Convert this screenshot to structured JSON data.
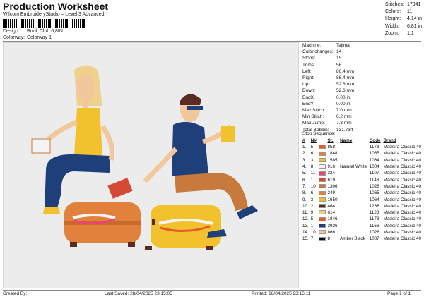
{
  "header": {
    "title": "Production Worksheet",
    "subtitle": "Wilcom EmbroideryStudio – Level 3 Advanced",
    "design_label": "Design:",
    "design_value": "Book Club 6,8IN",
    "colorway_label": "Colorway:",
    "colorway_value": "Colorway 1"
  },
  "stats": [
    {
      "label": "Stitches:",
      "value": "17941"
    },
    {
      "label": "Colors:",
      "value": "11"
    },
    {
      "label": "Height:",
      "value": "4.14 in"
    },
    {
      "label": "Width:",
      "value": "6.81 in"
    },
    {
      "label": "Zoom:",
      "value": "1:1"
    }
  ],
  "properties": [
    {
      "label": "Machine:",
      "value": "Tajima"
    },
    {
      "label": "Color changes:",
      "value": "14"
    },
    {
      "label": "Stops:",
      "value": "15"
    },
    {
      "label": "Trims:",
      "value": "56"
    },
    {
      "label": "Left:",
      "value": "86.4 mm"
    },
    {
      "label": "Right:",
      "value": "86.4 mm"
    },
    {
      "label": "Up:",
      "value": "52.6 mm"
    },
    {
      "label": "Down:",
      "value": "52.6 mm"
    },
    {
      "label": "EndX:",
      "value": "0.00 in"
    },
    {
      "label": "EndY:",
      "value": "0.00 in"
    },
    {
      "label": "Max Stitch:",
      "value": "7.0 mm"
    },
    {
      "label": "Min Stitch:",
      "value": "0.2 mm"
    },
    {
      "label": "Max Jump:",
      "value": "7.3 mm"
    },
    {
      "label": "Total Bobbin:",
      "value": "131.73ft"
    }
  ],
  "sequence": {
    "title": "Stop Sequence:",
    "headers": [
      "#",
      "N#",
      "",
      "St.",
      "Name",
      "Code",
      "Brand"
    ],
    "rows": [
      {
        "n": "1.",
        "nn": "5",
        "color": "#e85a2c",
        "st": "858",
        "name": "",
        "code": "1173",
        "brand": "Madeira Classic 40"
      },
      {
        "n": "2.",
        "nn": "6",
        "color": "#e2813c",
        "st": "1848",
        "name": "",
        "code": "1065",
        "brand": "Madeira Classic 40"
      },
      {
        "n": "3.",
        "nn": "3",
        "color": "#f2c12e",
        "st": "1585",
        "name": "",
        "code": "1064",
        "brand": "Madeira Classic 40"
      },
      {
        "n": "4.",
        "nn": "8",
        "color": "#f4f4f4",
        "st": "916",
        "name": "Natural White",
        "code": "1004",
        "brand": "Madeira Classic 40"
      },
      {
        "n": "5.",
        "nn": "11",
        "color": "#e7466e",
        "st": "324",
        "name": "",
        "code": "1107",
        "brand": "Madeira Classic 40"
      },
      {
        "n": "6.",
        "nn": "1",
        "color": "#d44a36",
        "st": "619",
        "name": "",
        "code": "1146",
        "brand": "Madeira Classic 40"
      },
      {
        "n": "7.",
        "nn": "10",
        "color": "#c77a3c",
        "st": "1306",
        "name": "",
        "code": "1026",
        "brand": "Madeira Classic 40"
      },
      {
        "n": "8.",
        "nn": "6",
        "color": "#e2813c",
        "st": "249",
        "name": "",
        "code": "1065",
        "brand": "Madeira Classic 40"
      },
      {
        "n": "9.",
        "nn": "3",
        "color": "#f2c12e",
        "st": "1650",
        "name": "",
        "code": "1064",
        "brand": "Madeira Classic 40"
      },
      {
        "n": "10.",
        "nn": "2",
        "color": "#5a2a24",
        "st": "464",
        "name": "",
        "code": "1236",
        "brand": "Madeira Classic 40"
      },
      {
        "n": "11.",
        "nn": "9",
        "color": "#efd18e",
        "st": "614",
        "name": "",
        "code": "1123",
        "brand": "Madeira Classic 40"
      },
      {
        "n": "12.",
        "nn": "5",
        "color": "#e85a2c",
        "st": "1846",
        "name": "",
        "code": "1173",
        "brand": "Madeira Classic 40"
      },
      {
        "n": "13.",
        "nn": "1",
        "color": "#1f3f7a",
        "st": "3936",
        "name": "",
        "code": "1166",
        "brand": "Madeira Classic 40"
      },
      {
        "n": "14.",
        "nn": "10",
        "color": "#f2c79c",
        "st": "866",
        "name": "",
        "code": "1026",
        "brand": "Madeira Classic 40"
      },
      {
        "n": "15.",
        "nn": "7",
        "color": "#111111",
        "st": "8",
        "name": "Amber Black",
        "code": "1007",
        "brand": "Madeira Classic 40"
      }
    ]
  },
  "footer": {
    "created_by": "Created By:",
    "last_saved": "Last Saved: 28/04/2025 23:15:05",
    "printed": "Printed: 28/04/2025 23:15:11",
    "page": "Page 1 of 1"
  }
}
